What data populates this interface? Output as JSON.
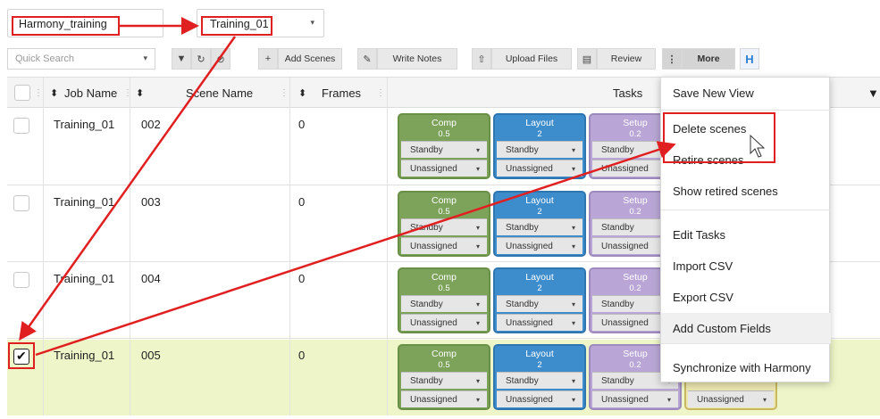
{
  "project_select": {
    "value": "Harmony_training",
    "caret": "▾"
  },
  "scene_select": {
    "value": "Training_01",
    "caret": "▾"
  },
  "search": {
    "placeholder": "Quick Search",
    "caret": "▾"
  },
  "toolbar": {
    "filter_icon": "▼",
    "refresh_icon": "↻",
    "clear_icon": "⊘",
    "plus_icon": "+",
    "add_scenes": "Add Scenes",
    "edit_icon": "✎",
    "write_notes": "Write Notes",
    "upload_icon": "⇧",
    "upload_files": "Upload Files",
    "review_icon": "▤",
    "review": "Review",
    "more_icon": "⋮",
    "more": "More",
    "harmony_icon": "H"
  },
  "columns": {
    "job": "Job Name",
    "scene": "Scene Name",
    "frames": "Frames",
    "tasks": "Tasks",
    "sort_icon": "⬍",
    "filter_icon": "▼",
    "col_menu": "⋮"
  },
  "rows": [
    {
      "job": "Training_01",
      "scene": "002",
      "frames": "0",
      "checked": false
    },
    {
      "job": "Training_01",
      "scene": "003",
      "frames": "0",
      "checked": false
    },
    {
      "job": "Training_01",
      "scene": "004",
      "frames": "0",
      "checked": false
    },
    {
      "job": "Training_01",
      "scene": "005",
      "frames": "0",
      "checked": true,
      "check_mark": "✔"
    }
  ],
  "tasks": {
    "comp": {
      "name": "Comp",
      "value": "0.5"
    },
    "layout": {
      "name": "Layout",
      "value": "2"
    },
    "setup": {
      "name": "Setup",
      "value": "0.2"
    },
    "status": "Standby",
    "assignee": "Unassigned",
    "caret": "▾"
  },
  "more_menu": {
    "items": [
      "Save New View",
      "Delete scenes",
      "Retire scenes",
      "Show retired scenes",
      "Edit Tasks",
      "Import CSV",
      "Export CSV",
      "Add Custom Fields",
      "Synchronize with Harmony"
    ]
  },
  "colors": {
    "annotation_red": "#e02020",
    "selected_row": "#eef5c8",
    "comp": "#7da35b",
    "layout": "#3d8ccc",
    "setup": "#b9a6d6",
    "harmony_blue": "#2b7fd4"
  }
}
